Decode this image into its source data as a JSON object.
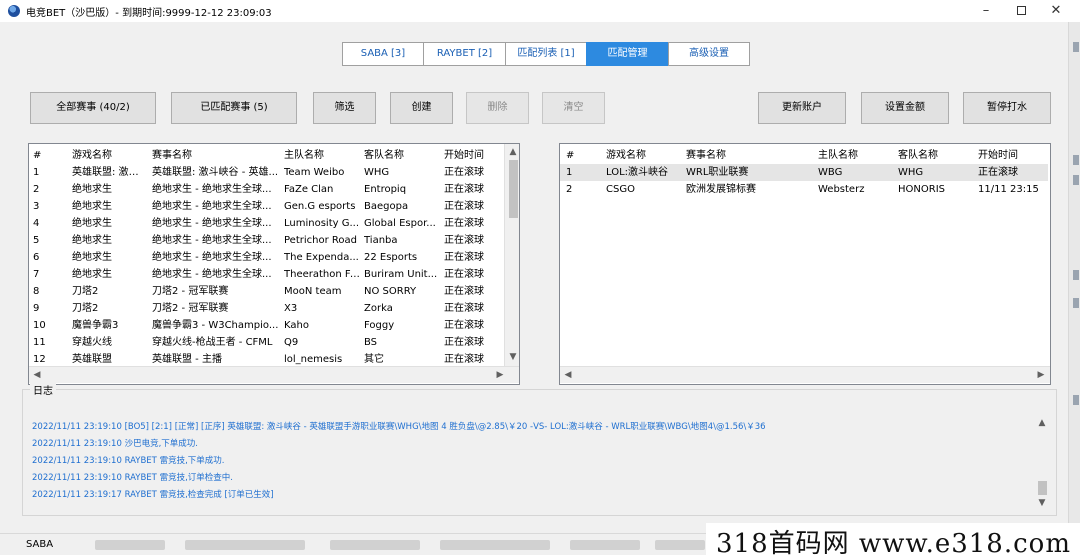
{
  "window": {
    "title": "电竞BET（沙巴版）- 到期时间:9999-12-12 23:09:03",
    "minimize_glyph": "–",
    "close_glyph": "✕"
  },
  "tabs": [
    {
      "label": "SABA [3]",
      "active": false
    },
    {
      "label": "RAYBET [2]",
      "active": false
    },
    {
      "label": "匹配列表 [1]",
      "active": false
    },
    {
      "label": "匹配管理",
      "active": true
    },
    {
      "label": "高级设置",
      "active": false
    }
  ],
  "toolbar": {
    "all_events": "全部赛事 (40/2)",
    "matched_events": "已匹配赛事 (5)",
    "filter": "筛选",
    "create": "创建",
    "delete": "删除",
    "clear": "清空",
    "refresh_accounts": "更新账户",
    "set_amount": "设置金额",
    "pause_betting": "暂停打水"
  },
  "left_table": {
    "columns": [
      "#",
      "游戏名称",
      "赛事名称",
      "主队名称",
      "客队名称",
      "开始时间"
    ],
    "rows": [
      [
        "1",
        "英雄联盟: 激斗...",
        "英雄联盟: 激斗峡谷 - 英雄...",
        "Team Weibo",
        "WHG",
        "正在滚球"
      ],
      [
        "2",
        "绝地求生",
        "绝地求生 - 绝地求生全球...",
        "FaZe Clan",
        "Entropiq",
        "正在滚球"
      ],
      [
        "3",
        "绝地求生",
        "绝地求生 - 绝地求生全球...",
        "Gen.G esports",
        "Baegopa",
        "正在滚球"
      ],
      [
        "4",
        "绝地求生",
        "绝地求生 - 绝地求生全球...",
        "Luminosity G...",
        "Global Espor...",
        "正在滚球"
      ],
      [
        "5",
        "绝地求生",
        "绝地求生 - 绝地求生全球...",
        "Petrichor Road",
        "Tianba",
        "正在滚球"
      ],
      [
        "6",
        "绝地求生",
        "绝地求生 - 绝地求生全球...",
        "The Expenda...",
        "22 Esports",
        "正在滚球"
      ],
      [
        "7",
        "绝地求生",
        "绝地求生 - 绝地求生全球...",
        "Theerathon Fi...",
        "Buriram Unit...",
        "正在滚球"
      ],
      [
        "8",
        "刀塔2",
        "刀塔2 - 冠军联赛",
        "MooN team",
        "NO SORRY",
        "正在滚球"
      ],
      [
        "9",
        "刀塔2",
        "刀塔2 - 冠军联赛",
        "X3",
        "Zorka",
        "正在滚球"
      ],
      [
        "10",
        "魔兽争霸3",
        "魔兽争霸3 - W3Champio...",
        "Kaho",
        "Foggy",
        "正在滚球"
      ],
      [
        "11",
        "穿越火线",
        "穿越火线-枪战王者 - CFML",
        "Q9",
        "BS",
        "正在滚球"
      ],
      [
        "12",
        "英雄联盟",
        "英雄联盟 - 主播",
        "lol_nemesis",
        "其它",
        "正在滚球"
      ]
    ]
  },
  "right_table": {
    "columns": [
      "#",
      "游戏名称",
      "赛事名称",
      "主队名称",
      "客队名称",
      "开始时间"
    ],
    "rows": [
      [
        "1",
        "LOL:激斗峡谷",
        "WRL职业联赛",
        "WBG",
        "WHG",
        "正在滚球"
      ],
      [
        "2",
        "CSGO",
        "欧洲发展锦标赛",
        "Websterz",
        "HONORIS",
        "11/11 23:15"
      ]
    ]
  },
  "log": {
    "title": "日志",
    "lines": [
      "2022/11/11 23:19:10 [BO5] [2:1] [正常] [正序] 英雄联盟: 激斗峡谷 - 英雄联盟手游职业联赛\\WHG\\地图 4 胜负盘\\@2.85\\￥20 -VS- LOL:激斗峡谷 - WRL职业联赛\\WBG\\地图4\\@1.56\\￥36",
      "2022/11/11 23:19:10 沙巴电竞,下单成功.",
      "2022/11/11 23:19:10 RAYBET 雷竞技,下单成功.",
      "2022/11/11 23:19:10 RAYBET 雷竞技,订单检查中.",
      "2022/11/11 23:19:17 RAYBET 雷竞技,检查完成 [订单已生效]"
    ]
  },
  "statusbar": {
    "label": "SABA"
  },
  "watermark": "318首码网  www.e318.com",
  "colors": {
    "accent": "#2d8ae0",
    "tab_text": "#1a5fb4",
    "log_text": "#1f6fd0"
  }
}
